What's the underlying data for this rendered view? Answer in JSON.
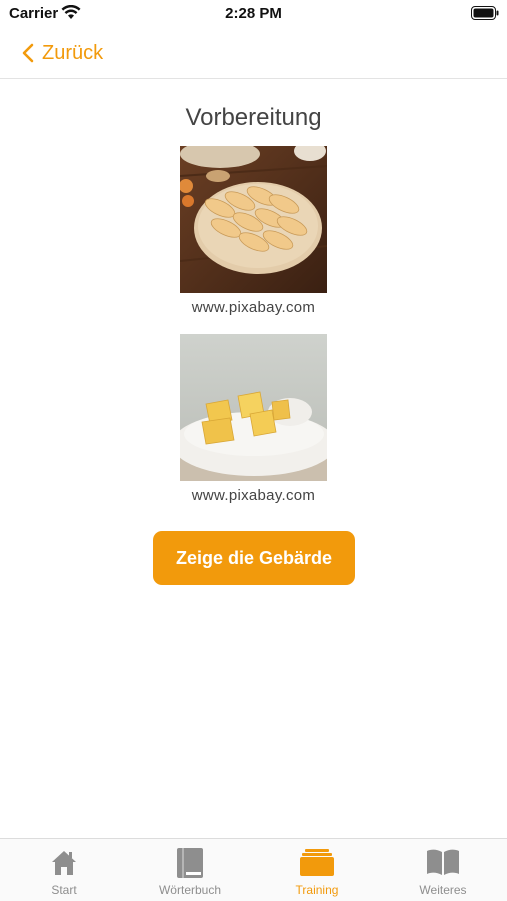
{
  "status_bar": {
    "carrier": "Carrier",
    "time": "2:28 PM"
  },
  "nav": {
    "back_label": "Zurück"
  },
  "main": {
    "title": "Vorbereitung",
    "images": [
      {
        "icon": "dough-pastries-photo",
        "caption": "www.pixabay.com"
      },
      {
        "icon": "butter-flour-photo",
        "caption": "www.pixabay.com"
      }
    ],
    "action_label": "Zeige die Gebärde"
  },
  "tab_bar": {
    "active_index": 2,
    "items": [
      {
        "label": "Start",
        "icon": "home-icon"
      },
      {
        "label": "Wörterbuch",
        "icon": "book-icon"
      },
      {
        "label": "Training",
        "icon": "cards-stack-icon"
      },
      {
        "label": "Weiteres",
        "icon": "open-book-icon"
      }
    ]
  },
  "colors": {
    "accent": "#f29a0c",
    "inactive": "#8e8e8e"
  }
}
